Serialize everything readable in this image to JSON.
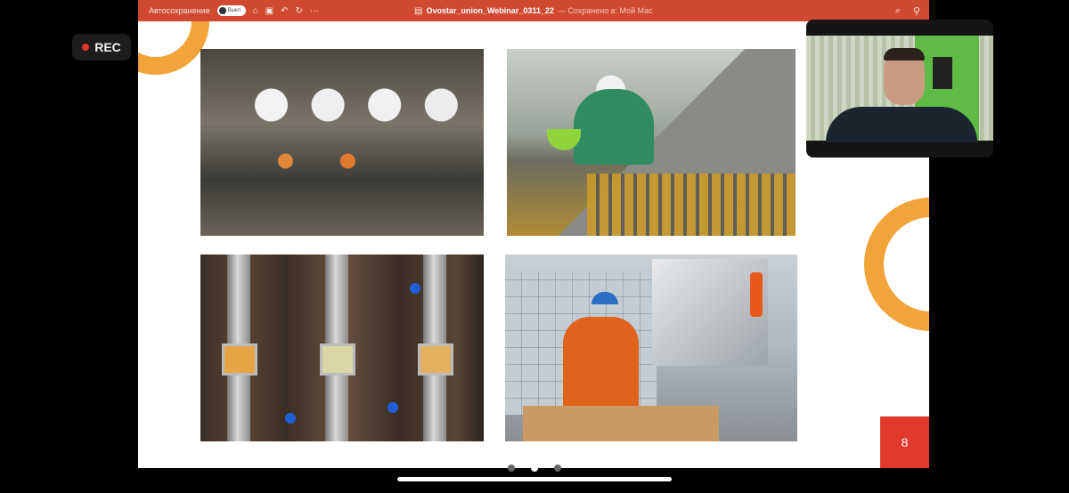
{
  "titlebar": {
    "autosave_label": "Автосохранение",
    "autosave_toggle": "Выкл.",
    "filename": "Ovostar_union_Webinar_0311_22",
    "saved_status": "— Сохранено в: Мой Mac",
    "icons": [
      "home-icon",
      "save-icon",
      "undo-icon",
      "redo-icon",
      "more-icon",
      "search-icon",
      "share-icon"
    ],
    "color": "#d04a32"
  },
  "rec": {
    "label": "REC"
  },
  "slide": {
    "page_number": "8",
    "accent_color": "#f0a43a",
    "page_box_color": "#e1392e"
  },
  "pager": {
    "count": 3,
    "active_index": 1
  }
}
